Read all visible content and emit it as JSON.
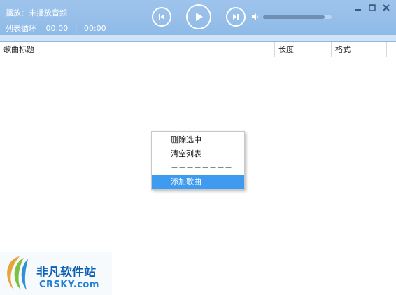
{
  "player": {
    "now_playing": "播放：未播放音频",
    "play_mode": "列表循环",
    "current_time": "00:00",
    "separator": "|",
    "total_time": "00:00",
    "volume_level": 0.9,
    "progress": 0.0
  },
  "icons": {
    "prev": "skip-previous-icon",
    "play": "play-icon",
    "next": "skip-next-icon",
    "volume": "speaker-icon",
    "minimize": "minimize-icon",
    "maximize": "maximize-icon",
    "close": "close-icon"
  },
  "table": {
    "columns": [
      "歌曲标题",
      "长度",
      "格式"
    ],
    "rows": []
  },
  "context_menu": {
    "items": [
      "删除选中",
      "清空列表",
      "－－－－－－－－",
      "添加歌曲"
    ],
    "selected_index": 3
  },
  "watermark": {
    "text_cn": "非凡软件站",
    "text_en": "CRSKY.com"
  },
  "colors": {
    "header": "#8cb8e6",
    "menu_highlight": "#3e9bf0"
  }
}
